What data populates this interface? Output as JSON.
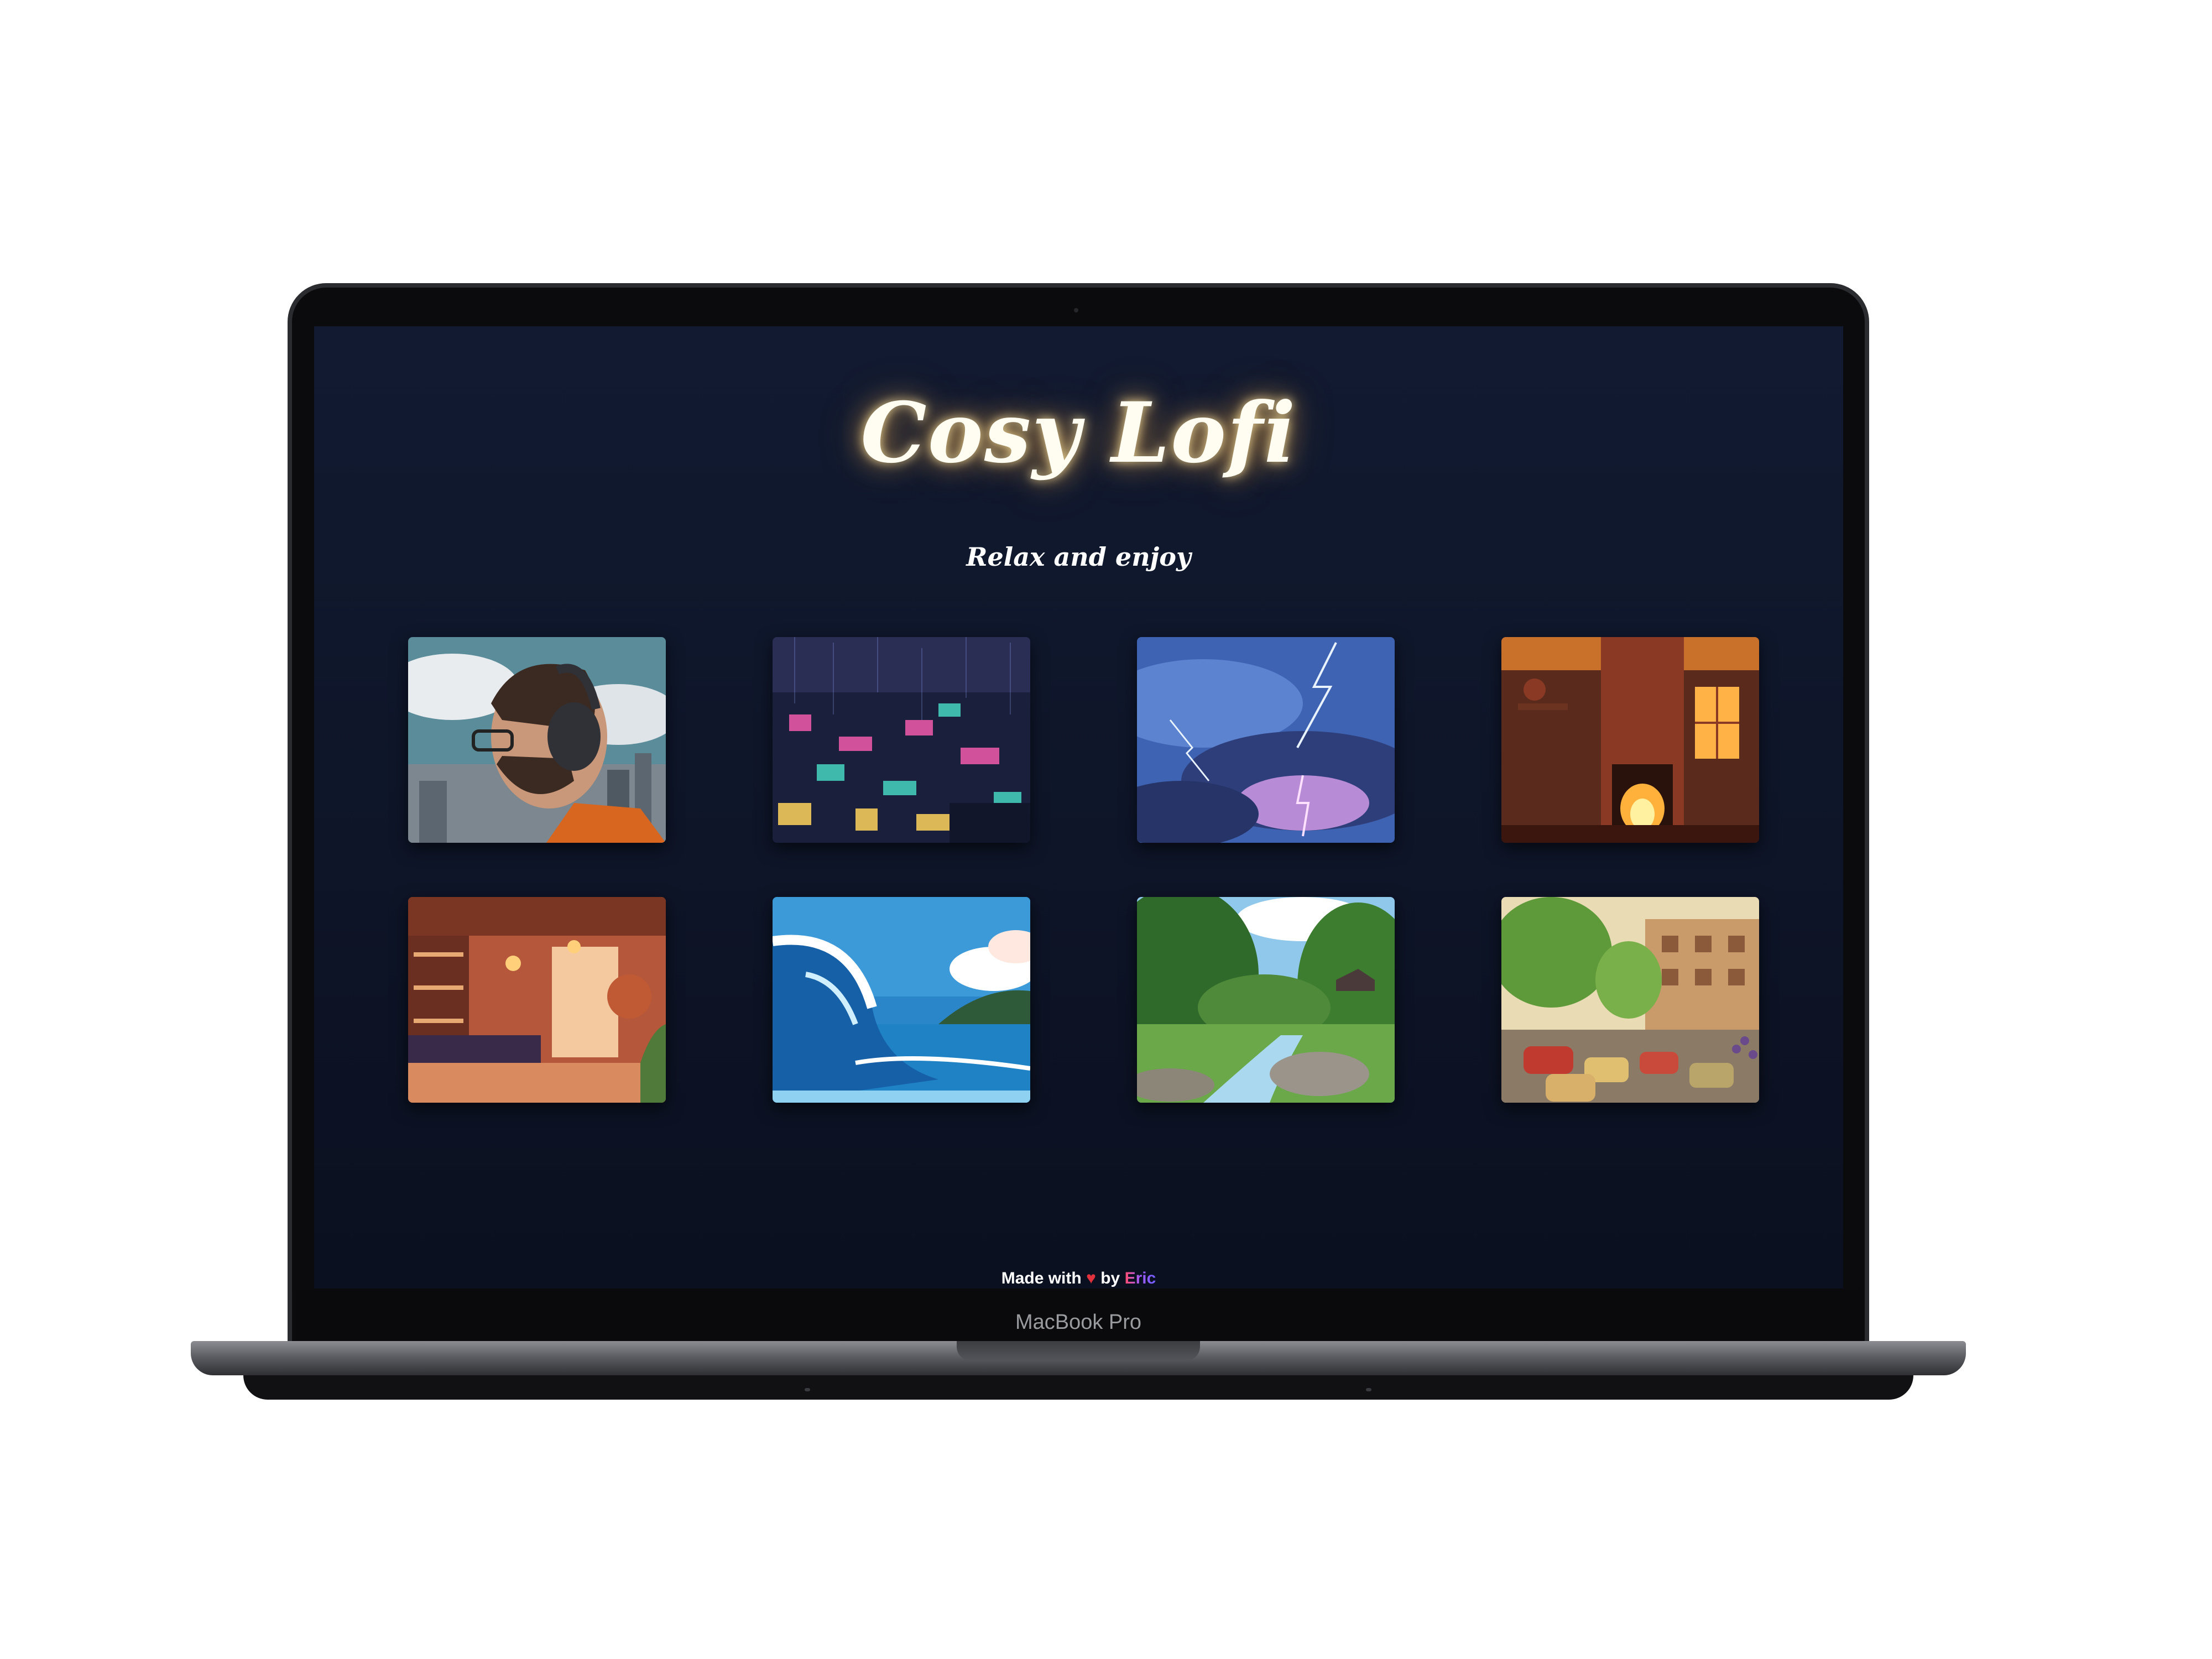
{
  "device": {
    "model_label": "MacBook Pro"
  },
  "page": {
    "title": "Cosy Lofi",
    "subtitle": "Relax and enjoy"
  },
  "scenes": [
    {
      "name": "man-with-headphones-icon"
    },
    {
      "name": "rainy-city-night-icon"
    },
    {
      "name": "lightning-storm-icon"
    },
    {
      "name": "fireplace-room-icon"
    },
    {
      "name": "coffee-shop-icon"
    },
    {
      "name": "ocean-wave-icon"
    },
    {
      "name": "forest-river-icon"
    },
    {
      "name": "busy-street-icon"
    }
  ],
  "footer": {
    "made_with": "Made with",
    "heart": "♥",
    "by": "by",
    "author": "Eric"
  },
  "colors": {
    "background": "#0e1528",
    "title_glow": "#ffbe5a",
    "heart": "#e0313d"
  }
}
